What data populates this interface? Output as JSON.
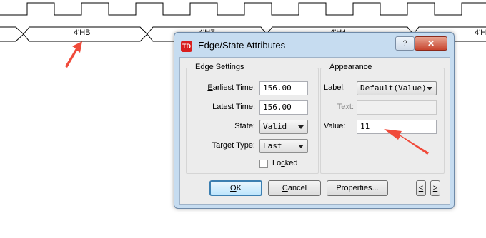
{
  "waveform": {
    "bus_values": [
      "4'HB",
      "4'HZ",
      "4'H4",
      "4'H"
    ]
  },
  "dialog": {
    "title": "Edge/State Attributes",
    "icon_text": "TD",
    "help_label": "?",
    "close_label": "✕",
    "edge_settings": {
      "title": "Edge Settings",
      "earliest_time_label_u": "E",
      "earliest_time_label_rest": "arliest Time:",
      "earliest_time_value": "156.00",
      "latest_time_label_u": "L",
      "latest_time_label_rest": "atest Time:",
      "latest_time_value": "156.00",
      "state_label": "State:",
      "state_value": "Valid",
      "target_type_label": "Target Type:",
      "target_type_value": "Last",
      "locked_label_pre": "Lo",
      "locked_label_u": "c",
      "locked_label_post": "ked",
      "locked_checked": false
    },
    "appearance": {
      "title": "Appearance",
      "label_label": "Label:",
      "label_value": "Default(Value)",
      "text_label": "Text:",
      "text_value": "",
      "value_label": "Value:",
      "value_value": "11"
    },
    "buttons": {
      "ok_u": "O",
      "ok_rest": "K",
      "cancel_u": "C",
      "cancel_rest": "ancel",
      "properties": "Properties...",
      "prev_u": "<",
      "next_u": ">"
    }
  },
  "colors": {
    "dialog_frame": "#c6dcf0",
    "annotation_arrow": "#f04a3a",
    "default_button_border": "#3c7fb1"
  }
}
